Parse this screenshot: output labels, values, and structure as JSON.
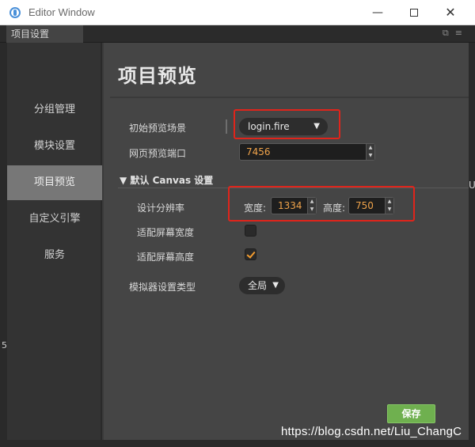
{
  "window": {
    "title": "Editor Window",
    "min_glyph": "—",
    "close_glyph": "✕"
  },
  "tab": {
    "label": "项目设置",
    "icons": "⧉≡"
  },
  "sidebar": {
    "items": [
      {
        "label": "分组管理",
        "active": false
      },
      {
        "label": "模块设置",
        "active": false
      },
      {
        "label": "项目预览",
        "active": true
      },
      {
        "label": "自定义引擎",
        "active": false
      },
      {
        "label": "服务",
        "active": false
      }
    ]
  },
  "main": {
    "title": "项目预览",
    "initial_scene_label": "初始预览场景",
    "initial_scene_value": "login.fire",
    "port_label": "网页预览端口",
    "port_value": "7456",
    "canvas_section": "▼ 默认 Canvas 设置",
    "resolution_label": "设计分辨率",
    "width_label": "宽度:",
    "width_value": "1334",
    "height_label": "高度:",
    "height_value": "750",
    "fit_width_label": "适配屏幕宽度",
    "fit_width_checked": false,
    "fit_height_label": "适配屏幕高度",
    "fit_height_checked": true,
    "simulator_label": "模拟器设置类型",
    "simulator_value": "全局",
    "dropdown_arrow": "▼",
    "spin_up": "▲",
    "spin_down": "▼",
    "save_label": "保存"
  },
  "background": {
    "right_char": "U",
    "left_char": "5"
  },
  "watermark": "https://blog.csdn.net/Liu_ChangC",
  "colors": {
    "accent_orange": "#f39c2f",
    "highlight_red": "#e0241b",
    "save_green": "#6fb04f",
    "active_sidebar": "#777777"
  }
}
